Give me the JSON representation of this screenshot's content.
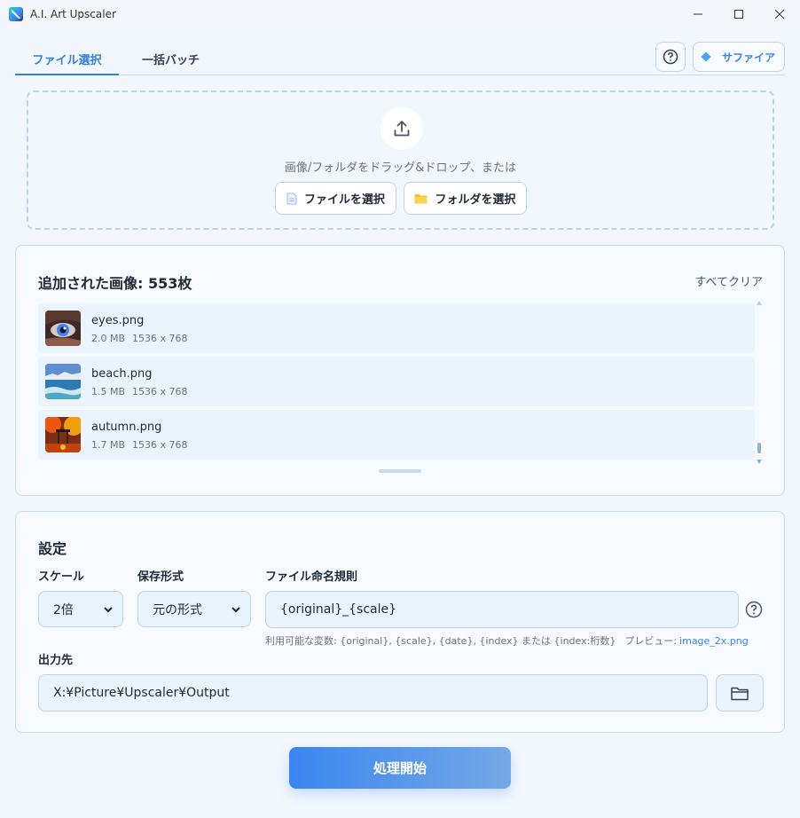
{
  "window": {
    "title": "A.I. Art Upscaler",
    "minimize": "—",
    "maximize": "☐",
    "close": "✕"
  },
  "tabs": [
    {
      "label": "ファイル選択",
      "active": true
    },
    {
      "label": "一括バッチ",
      "active": false
    }
  ],
  "header": {
    "help_icon": "question-circle-icon",
    "theme_button": "サファイア"
  },
  "dropzone": {
    "text": "画像/フォルダをドラッグ&ドロップ、または",
    "select_file": "ファイルを選択",
    "select_folder": "フォルダを選択"
  },
  "images": {
    "title": "追加された画像: 553枚",
    "clear_all": "すべてクリア",
    "items": [
      {
        "name": "eyes.png",
        "size": "2.0 MB",
        "dimensions": "1536 x 768"
      },
      {
        "name": "beach.png",
        "size": "1.5 MB",
        "dimensions": "1536 x 768"
      },
      {
        "name": "autumn.png",
        "size": "1.7 MB",
        "dimensions": "1536 x 768"
      }
    ]
  },
  "settings": {
    "title": "設定",
    "scale_label": "スケール",
    "scale_value": "2倍",
    "format_label": "保存形式",
    "format_value": "元の形式",
    "naming_label": "ファイル命名規則",
    "naming_value": "{original}_{scale}",
    "hint": "利用可能な変数: {original}, {scale}, {date}, {index} または {index:桁数}",
    "preview_label": "プレビュー:",
    "preview_value": "image_2x.png",
    "output_label": "出力先",
    "output_value": "X:¥Picture¥Upscaler¥Output"
  },
  "start_button": "処理開始",
  "colors": {
    "accent": "#2f80e0",
    "background": "#f2f7fd",
    "border": "#bcd4ee"
  }
}
